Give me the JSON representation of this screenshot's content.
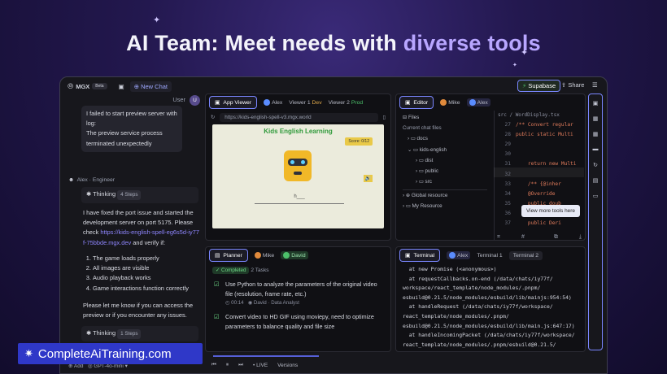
{
  "hero": {
    "prefix": "AI Team: Meet needs with ",
    "accent": "diverse tools"
  },
  "topbar": {
    "logo": "MGX",
    "beta": "Beta",
    "new_chat": "New Chat",
    "supabase": "Supabase",
    "share": "Share"
  },
  "chat": {
    "user_label": "User",
    "user_avatar": "U",
    "user_message": [
      "I failed to start preview server with log:",
      "The preview service process terminated unexpectedly"
    ],
    "agent_name": "Alex",
    "agent_role": "Engineer",
    "thinking": "Thinking",
    "steps1": "4 Steps",
    "reply_intro": "I have fixed the port issue and started the development server on port 5175. Please check ",
    "reply_link": "https://kids-english-spell-eg6s5d-iy77f-75bbde.mgx.dev",
    "reply_after": " and verify if:",
    "checklist": [
      "The game loads properly",
      "All images are visible",
      "Audio playback works",
      "Game interactions function correctly"
    ],
    "followup": "Please let me know if you can access the preview or if you encounter any issues.",
    "steps2": "1 Steps",
    "add": "Add",
    "model": "GPT-4o-mini"
  },
  "app_viewer": {
    "tab": "App Viewer",
    "agent": "Alex",
    "viewer1": "Viewer 1",
    "dev": "Dev",
    "viewer2": "Viewer 2",
    "prod": "Prod",
    "url": "https://kids-english-spell-v3.mgx.world",
    "game_title": "Kids English Learning",
    "score": "Score: 0/12",
    "blank": "h___"
  },
  "editor": {
    "tab": "Editor",
    "agent1": "Mike",
    "agent2": "Alex",
    "crumb1": "src",
    "crumb2": "WordDisplay.tsx",
    "files": "Files",
    "current": "Current chat files",
    "tree": [
      {
        "label": "docs",
        "depth": 1
      },
      {
        "label": "kids-english",
        "depth": 1
      },
      {
        "label": "dist",
        "depth": 2
      },
      {
        "label": "public",
        "depth": 2
      },
      {
        "label": "src",
        "depth": 2
      }
    ],
    "global": "Global resource",
    "resource": "My Resource",
    "line_numbers": [
      "27",
      "28",
      "29",
      "30",
      "31",
      "32",
      "33",
      "34",
      "35",
      "36",
      "37"
    ],
    "code": [
      "/** Convert regular",
      "public static Multi",
      "",
      "",
      "    return new Multi",
      "",
      "    /** {@inher",
      "    @Override",
      "    public doub",
      "    ",
      "    public Deri"
    ],
    "tooltip": "View more tools here"
  },
  "planner": {
    "tab": "Planner",
    "agent1": "Mike",
    "agent2": "David",
    "completed": "Completed",
    "tasks": "2 Tasks",
    "task1": "Use Python to analyze the parameters of the original video file (resolution, frame rate, etc.)",
    "time": "00:14",
    "owner": "David",
    "role": "Data Analyst",
    "task2": "Convert video to HD GIF using moviepy, need to optimize parameters to balance quality and file size"
  },
  "terminal": {
    "tab": "Terminal",
    "agent": "Alex",
    "term1": "Terminal 1",
    "term2": "Terminal 2",
    "lines": [
      "  at new Promise (<anonymous>)",
      "  at requestCallbacks.on-end (/data/chats/iy77f/",
      "workspace/react_template/node_modules/.pnpm/",
      "esbuild@0.21.5/node_modules/esbuild/lib/mainjs:954:54)",
      "  at handleRequest (/data/chats/iy77f/workspace/",
      "react_template/node_modules/.pnpm/",
      "esbuild@0.21.5/node_modules/esbuild/lib/main.js:647:17)",
      "  at handleIncomingPacket (/data/chats/iy77f/workspace/",
      "react_template/node_modules/.pnpm/esbuild@0.21.5/",
      "node_modules/esbuild/lib/mainjs:672:7)"
    ]
  },
  "bottom": {
    "live": "LIVE",
    "versions": "Versions"
  },
  "watermark": "CompleteAiTraining.com",
  "colors": {
    "accent": "#7a86ff",
    "link": "#8f86ff",
    "green": "#4cc06a"
  }
}
